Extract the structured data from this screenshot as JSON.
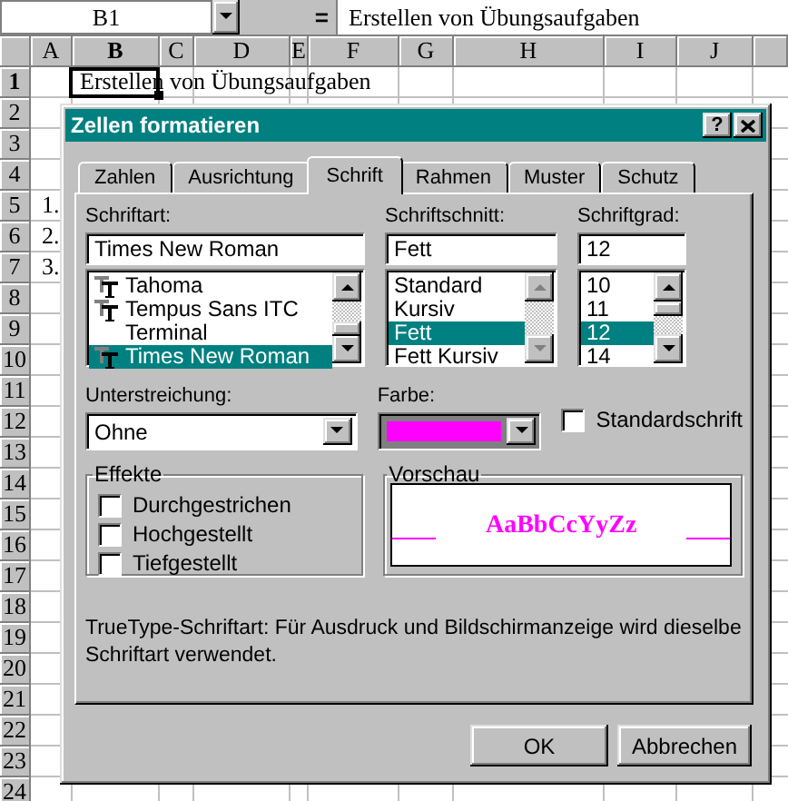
{
  "formula_bar": {
    "name_box": "B1",
    "equals": "=",
    "value": "Erstellen von Übungsaufgaben"
  },
  "sheet": {
    "columns": [
      {
        "label": "A",
        "selected": false
      },
      {
        "label": "B",
        "selected": true
      },
      {
        "label": "C",
        "selected": false
      },
      {
        "label": "D",
        "selected": false
      },
      {
        "label": "E",
        "selected": false
      },
      {
        "label": "F",
        "selected": false
      },
      {
        "label": "G",
        "selected": false
      },
      {
        "label": "H",
        "selected": false
      },
      {
        "label": "I",
        "selected": false
      },
      {
        "label": "J",
        "selected": false
      }
    ],
    "rows": [
      {
        "label": "1",
        "selected": true,
        "col_b": "Erstellen von Übungsaufgaben"
      },
      {
        "label": "2",
        "selected": false
      },
      {
        "label": "3",
        "selected": false
      },
      {
        "label": "4",
        "selected": false
      },
      {
        "label": "5",
        "selected": false,
        "col_a": "1."
      },
      {
        "label": "6",
        "selected": false,
        "col_a": "2."
      },
      {
        "label": "7",
        "selected": false,
        "col_a": "3."
      },
      {
        "label": "8",
        "selected": false
      },
      {
        "label": "9",
        "selected": false
      },
      {
        "label": "10",
        "selected": false
      },
      {
        "label": "11",
        "selected": false
      },
      {
        "label": "12",
        "selected": false
      },
      {
        "label": "13",
        "selected": false
      },
      {
        "label": "14",
        "selected": false
      },
      {
        "label": "15",
        "selected": false
      },
      {
        "label": "16",
        "selected": false
      },
      {
        "label": "17",
        "selected": false
      },
      {
        "label": "18",
        "selected": false
      },
      {
        "label": "19",
        "selected": false
      },
      {
        "label": "20",
        "selected": false
      },
      {
        "label": "21",
        "selected": false
      },
      {
        "label": "22",
        "selected": false
      },
      {
        "label": "23",
        "selected": false
      },
      {
        "label": "24",
        "selected": false
      }
    ]
  },
  "dialog": {
    "title": "Zellen formatieren",
    "help": "?",
    "tabs": [
      {
        "label": "Zahlen",
        "selected": false
      },
      {
        "label": "Ausrichtung",
        "selected": false
      },
      {
        "label": "Schrift",
        "selected": true
      },
      {
        "label": "Rahmen",
        "selected": false
      },
      {
        "label": "Muster",
        "selected": false
      },
      {
        "label": "Schutz",
        "selected": false
      }
    ],
    "font": {
      "label": "Schriftart:",
      "value": "Times New Roman",
      "items": [
        {
          "label": "Tahoma",
          "truetype": true,
          "selected": false
        },
        {
          "label": "Tempus Sans ITC",
          "truetype": true,
          "selected": false
        },
        {
          "label": "Terminal",
          "truetype": false,
          "selected": false
        },
        {
          "label": "Times New Roman",
          "truetype": true,
          "selected": true
        }
      ]
    },
    "style": {
      "label": "Schriftschnitt:",
      "value": "Fett",
      "items": [
        {
          "label": "Standard",
          "selected": false
        },
        {
          "label": "Kursiv",
          "selected": false
        },
        {
          "label": "Fett",
          "selected": true
        },
        {
          "label": "Fett Kursiv",
          "selected": false
        }
      ]
    },
    "size": {
      "label": "Schriftgrad:",
      "value": "12",
      "items": [
        {
          "label": "10",
          "selected": false
        },
        {
          "label": "11",
          "selected": false
        },
        {
          "label": "12",
          "selected": true
        },
        {
          "label": "14",
          "selected": false
        }
      ]
    },
    "underline": {
      "label": "Unterstreichung:",
      "value": "Ohne"
    },
    "color": {
      "label": "Farbe:",
      "color": "#ff00ff"
    },
    "standard_font": {
      "label": "Standardschrift",
      "checked": false
    },
    "effects": {
      "title": "Effekte",
      "items": [
        {
          "label": "Durchgestrichen",
          "checked": false
        },
        {
          "label": "Hochgestellt",
          "checked": false
        },
        {
          "label": "Tiefgestellt",
          "checked": false
        }
      ]
    },
    "preview": {
      "title": "Vorschau",
      "sample": "AaBbCcYyZz"
    },
    "note": "TrueType-Schriftart: Für Ausdruck und Bildschirmanzeige wird dieselbe Schriftart verwendet.",
    "buttons": [
      "OK",
      "Abbrechen"
    ]
  }
}
